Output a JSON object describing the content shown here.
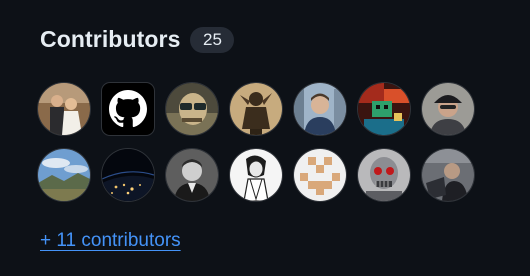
{
  "section": {
    "title": "Contributors",
    "count": "25"
  },
  "avatars": [
    {
      "name": "contributor-avatar-1",
      "style": "wedding-photo"
    },
    {
      "name": "contributor-avatar-2",
      "style": "github-logo"
    },
    {
      "name": "contributor-avatar-3",
      "style": "cartoon-sunglasses"
    },
    {
      "name": "contributor-avatar-4",
      "style": "sepia-figurine"
    },
    {
      "name": "contributor-avatar-5",
      "style": "man-portrait-city"
    },
    {
      "name": "contributor-avatar-6",
      "style": "pixel-game-art"
    },
    {
      "name": "contributor-avatar-7",
      "style": "man-cap-photo"
    },
    {
      "name": "contributor-avatar-8",
      "style": "landscape-sky"
    },
    {
      "name": "contributor-avatar-9",
      "style": "earth-night"
    },
    {
      "name": "contributor-avatar-10",
      "style": "bw-portrait"
    },
    {
      "name": "contributor-avatar-11",
      "style": "sketch-drawing"
    },
    {
      "name": "contributor-avatar-12",
      "style": "identicon"
    },
    {
      "name": "contributor-avatar-13",
      "style": "robot-skull"
    },
    {
      "name": "contributor-avatar-14",
      "style": "man-laptop"
    }
  ],
  "more_link": "+ 11 contributors",
  "colors": {
    "background": "#0d1117",
    "text": "#e6edf3",
    "counter_bg": "#262c36",
    "link": "#4493f8"
  }
}
